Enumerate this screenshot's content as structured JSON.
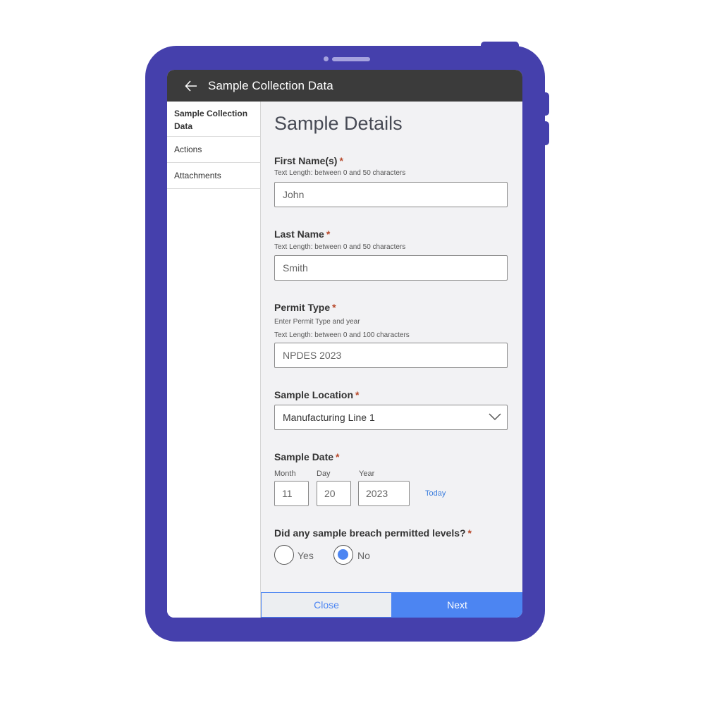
{
  "header": {
    "title": "Sample Collection Data",
    "back_icon": "arrow-left-icon"
  },
  "sidebar": {
    "items": [
      {
        "label": "Sample Collection Data",
        "active": true
      },
      {
        "label": "Actions",
        "active": false
      },
      {
        "label": "Attachments",
        "active": false
      }
    ]
  },
  "main": {
    "title": "Sample Details",
    "required_mark": "*",
    "first_name": {
      "label": "First Name(s)",
      "hint": "Text Length: between 0 and 50 characters",
      "value": "John"
    },
    "last_name": {
      "label": "Last Name",
      "hint": "Text Length: between 0 and 50 characters",
      "value": "Smith"
    },
    "permit_type": {
      "label": "Permit Type",
      "hint1": "Enter Permit Type and year",
      "hint2": "Text Length: between 0 and 100 characters",
      "value": "NPDES 2023"
    },
    "sample_location": {
      "label": "Sample Location",
      "value": "Manufacturing Line 1",
      "icon": "chevron-down-icon"
    },
    "sample_date": {
      "label": "Sample Date",
      "month_label": "Month",
      "month": "11",
      "day_label": "Day",
      "day": "20",
      "year_label": "Year",
      "year": "2023",
      "today_label": "Today"
    },
    "breach": {
      "label": "Did any sample breach permitted levels?",
      "yes": "Yes",
      "no": "No",
      "selected": "No"
    }
  },
  "footer": {
    "close_label": "Close",
    "next_label": "Next"
  },
  "colors": {
    "frame": "#4540AC",
    "header": "#3B3B3B",
    "accent": "#4C85F2",
    "required": "#B8492B",
    "panel": "#F2F2F4"
  }
}
